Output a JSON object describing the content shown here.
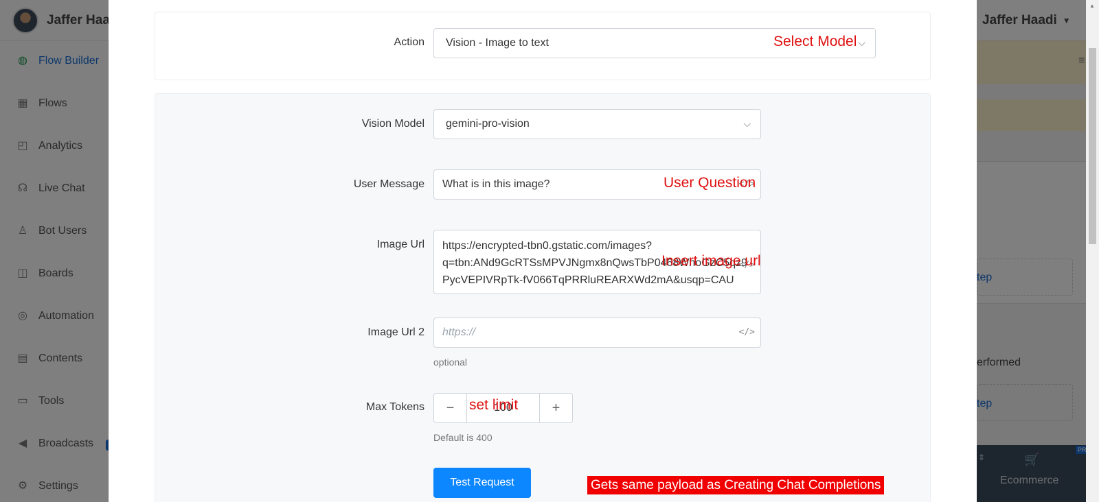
{
  "app": {
    "user_name": "Jaffer Haadi",
    "user_name_left": "Jaffer Haad",
    "sidebar": [
      {
        "label": "Flow Builder",
        "icon": "chat-bubbles-icon",
        "active": true
      },
      {
        "label": "Flows",
        "icon": "grid-icon"
      },
      {
        "label": "Analytics",
        "icon": "chart-board-icon"
      },
      {
        "label": "Live Chat",
        "icon": "headset-icon"
      },
      {
        "label": "Bot Users",
        "icon": "person-icon"
      },
      {
        "label": "Boards",
        "icon": "board-icon"
      },
      {
        "label": "Automation",
        "icon": "lifebuoy-icon"
      },
      {
        "label": "Contents",
        "icon": "contents-icon"
      },
      {
        "label": "Tools",
        "icon": "archive-icon"
      },
      {
        "label": "Broadcasts",
        "icon": "megaphone-icon"
      },
      {
        "label": "Settings",
        "icon": "gear-icon"
      }
    ],
    "right_panel": {
      "link_step_1": "tep",
      "performed_text": "erformed",
      "link_step_2": "tep",
      "ecommerce_label": "Ecommerce",
      "pro_badge": "PR"
    }
  },
  "modal": {
    "action": {
      "label": "Action",
      "value": "Vision - Image to text"
    },
    "vision_model": {
      "label": "Vision Model",
      "value": "gemini-pro-vision"
    },
    "user_message": {
      "label": "User Message",
      "value": "What is in this image?"
    },
    "image_url": {
      "label": "Image Url",
      "lines": [
        "https://encrypted-tbn0.gstatic.com/images?",
        "q=tbn:ANd9GcRTSsMPVJNgmx8nQwsTbP0468WhoGzC5qz9",
        "PycVEPIVRpTk-fV066TqPRRluREARXWd2mA&usqp=CAU"
      ]
    },
    "image_url_2": {
      "label": "Image Url 2",
      "placeholder": "https://",
      "help": "optional"
    },
    "max_tokens": {
      "label": "Max Tokens",
      "value": "100",
      "minus": "−",
      "plus": "+",
      "help": "Default is 400"
    },
    "test_button": "Test Request",
    "code_icon": "</>"
  },
  "annotations": {
    "select_model": "Select Model",
    "user_question": "User Question",
    "insert_image_url": "Insert image url",
    "set_limit": "set limit",
    "payload_note": "Gets same payload as Creating Chat Completions"
  },
  "colors": {
    "primary": "#0d87ff",
    "annotation_red": "#e01010",
    "link_blue": "#1b6fd6"
  }
}
